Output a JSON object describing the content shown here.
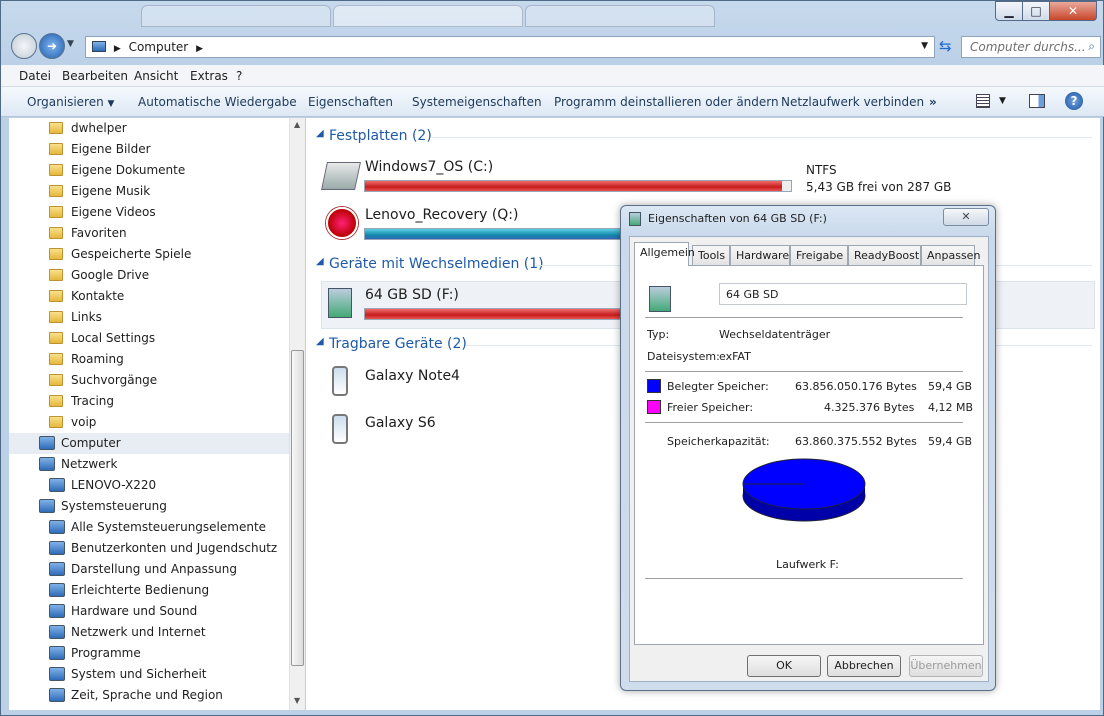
{
  "window": {
    "tabs": [
      "",
      "",
      ""
    ]
  },
  "address": {
    "path": "Computer",
    "search_placeholder": "Computer durchs..."
  },
  "menu": [
    "Datei",
    "Bearbeiten",
    "Ansicht",
    "Extras",
    "?"
  ],
  "commands": [
    "Organisieren",
    "Automatische Wiedergabe",
    "Eigenschaften",
    "Systemeigenschaften",
    "Programm deinstallieren oder ändern",
    "Netzlaufwerk verbinden",
    "»"
  ],
  "nav": {
    "folders": [
      "dwhelper",
      "Eigene Bilder",
      "Eigene Dokumente",
      "Eigene Musik",
      "Eigene Videos",
      "Favoriten",
      "Gespeicherte Spiele",
      "Google Drive",
      "Kontakte",
      "Links",
      "Local Settings",
      "Roaming",
      "Suchvorgänge",
      "Tracing",
      "voip"
    ],
    "computer": "Computer",
    "network": "Netzwerk",
    "network_child": "LENOVO-X220",
    "control_panel": "Systemsteuerung",
    "cp_items": [
      "Alle Systemsteuerungselemente",
      "Benutzerkonten und Jugendschutz",
      "Darstellung und Anpassung",
      "Erleichterte Bedienung",
      "Hardware und Sound",
      "Netzwerk und Internet",
      "Programme",
      "System und Sicherheit",
      "Zeit, Sprache und Region"
    ]
  },
  "main": {
    "group_hdd": "Festplatten (2)",
    "drive_c": {
      "name": "Windows7_OS (C:)",
      "fs": "NTFS",
      "free": "5,43 GB frei von 287 GB",
      "used_fraction": 0.98
    },
    "drive_q": {
      "name": "Lenovo_Recovery (Q:)",
      "used_fraction": 0.7
    },
    "group_removable": "Geräte mit Wechselmedien (1)",
    "drive_f": {
      "name": "64 GB SD (F:)"
    },
    "group_portable": "Tragbare Geräte (2)",
    "dev1": "Galaxy Note4",
    "dev2": "Galaxy S6"
  },
  "dialog": {
    "title": "Eigenschaften von 64 GB SD (F:)",
    "tabs": [
      "Allgemein",
      "Tools",
      "Hardware",
      "Freigabe",
      "ReadyBoost",
      "Anpassen"
    ],
    "name_value": "64 GB SD",
    "type_label": "Typ:",
    "type_value": "Wechseldatenträger",
    "fs_label": "Dateisystem:",
    "fs_value": "exFAT",
    "used_label": "Belegter Speicher:",
    "used_bytes": "63.856.050.176 Bytes",
    "used_size": "59,4 GB",
    "free_label": "Freier Speicher:",
    "free_bytes": "4.325.376 Bytes",
    "free_size": "4,12 MB",
    "cap_label": "Speicherkapazität:",
    "cap_bytes": "63.860.375.552 Bytes",
    "cap_size": "59,4 GB",
    "drive_label": "Laufwerk F:",
    "ok": "OK",
    "cancel": "Abbrechen",
    "apply": "Übernehmen",
    "used_color": "#0000ff",
    "free_color": "#ff00ff"
  }
}
